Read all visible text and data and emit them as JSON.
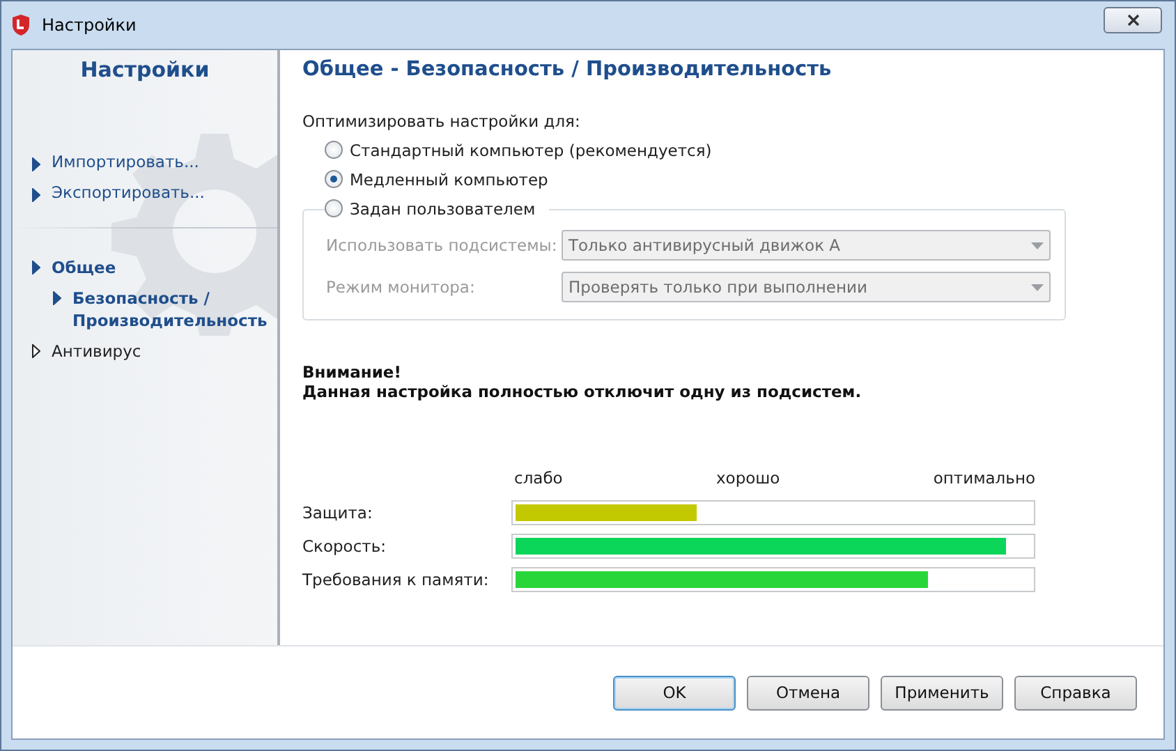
{
  "window": {
    "title": "Настройки"
  },
  "sidebar": {
    "title": "Настройки",
    "actions": [
      "Импортировать...",
      "Экспортировать..."
    ],
    "tree": [
      {
        "label": "Общее",
        "expanded": true,
        "children": [
          {
            "label": "Безопасность / Производительность",
            "selected": true
          }
        ]
      },
      {
        "label": "Антивирус",
        "expanded": false
      }
    ]
  },
  "page": {
    "title": "Общее - Безопасность / Производительность",
    "optimize_label": "Оптимизировать настройки для:",
    "options": [
      {
        "label": "Стандартный компьютер (рекомендуется)",
        "selected": false
      },
      {
        "label": "Медленный компьютер",
        "selected": true
      },
      {
        "label": "Задан пользователем",
        "selected": false
      }
    ],
    "custom": {
      "disabled": true,
      "fields": [
        {
          "label": "Использовать подсистемы:",
          "value": "Только антивирусный движок A"
        },
        {
          "label": "Режим монитора:",
          "value": "Проверять только при выполнении"
        }
      ]
    },
    "warning": {
      "title": "Внимание!",
      "text": "Данная настройка полностью отключит одну из подсистем."
    },
    "scale": [
      "слабо",
      "хорошо",
      "оптимально"
    ],
    "meters": [
      {
        "label": "Защита:",
        "level": 0.35,
        "color": "#c3c900"
      },
      {
        "label": "Скорость:",
        "level": 0.95,
        "color": "#0bd65a"
      },
      {
        "label": "Требования к памяти:",
        "level": 0.8,
        "color": "#29d63a"
      }
    ]
  },
  "buttons": [
    {
      "label": "OK",
      "default": true
    },
    {
      "label": "Отмена",
      "default": false
    },
    {
      "label": "Применить",
      "default": false
    },
    {
      "label": "Справка",
      "default": false
    }
  ]
}
